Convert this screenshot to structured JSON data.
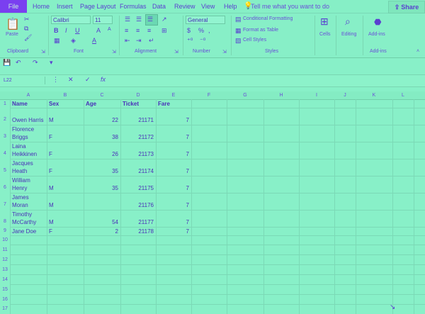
{
  "menu": {
    "file": "File",
    "items": [
      "Home",
      "Insert",
      "Page Layout",
      "Formulas",
      "Data",
      "Review",
      "View",
      "Help"
    ],
    "tell_me": "Tell me what you want to do",
    "share": "Share"
  },
  "ribbon": {
    "clipboard": {
      "paste": "Paste",
      "label": "Clipboard"
    },
    "font": {
      "name": "Calibri",
      "size": "11",
      "label": "Font"
    },
    "alignment": {
      "label": "Alignment"
    },
    "number": {
      "format": "General",
      "label": "Number"
    },
    "styles": {
      "conditional": "Conditional Formatting",
      "format_table": "Format as Table",
      "cell_styles": "Cell Styles",
      "label": "Styles"
    },
    "cells": {
      "label": "Cells"
    },
    "editing": {
      "label": "Editing"
    },
    "addins": {
      "button": "Add-ins",
      "label": "Add-ins"
    }
  },
  "formula_bar": {
    "name_box": "L22",
    "formula": ""
  },
  "columns": [
    "A",
    "B",
    "C",
    "D",
    "E",
    "F",
    "G",
    "H",
    "I",
    "J",
    "K",
    "L"
  ],
  "rows": [
    "1",
    "2",
    "3",
    "4",
    "5",
    "6",
    "7",
    "8",
    "9",
    "10",
    "11",
    "12",
    "13",
    "14",
    "15",
    "16",
    "17"
  ],
  "table": {
    "headers": [
      "Name",
      "Sex",
      "Age",
      "Ticket",
      "Fare"
    ],
    "rows": [
      {
        "name1": "Owen Harris",
        "name2": "",
        "sex": "M",
        "age": "22",
        "ticket": "21171",
        "fare": "7"
      },
      {
        "name1": "Florence",
        "name2": "Briggs",
        "sex": "F",
        "age": "38",
        "ticket": "21172",
        "fare": "7"
      },
      {
        "name1": "Laina",
        "name2": "Heikkinen",
        "sex": "F",
        "age": "26",
        "ticket": "21173",
        "fare": "7"
      },
      {
        "name1": "Jacques",
        "name2": "Heath",
        "sex": "F",
        "age": "35",
        "ticket": "21174",
        "fare": "7"
      },
      {
        "name1": "William",
        "name2": "Henry",
        "sex": "M",
        "age": "35",
        "ticket": "21175",
        "fare": "7"
      },
      {
        "name1": "James",
        "name2": "Moran",
        "sex": "M",
        "age": "",
        "ticket": "21176",
        "fare": "7"
      },
      {
        "name1": "Timothy",
        "name2": "McCarthy",
        "sex": "M",
        "age": "54",
        "ticket": "21177",
        "fare": "7"
      },
      {
        "name1": "Jane Doe",
        "name2": "",
        "sex": "F",
        "age": "2",
        "ticket": "21178",
        "fare": "7"
      }
    ]
  }
}
